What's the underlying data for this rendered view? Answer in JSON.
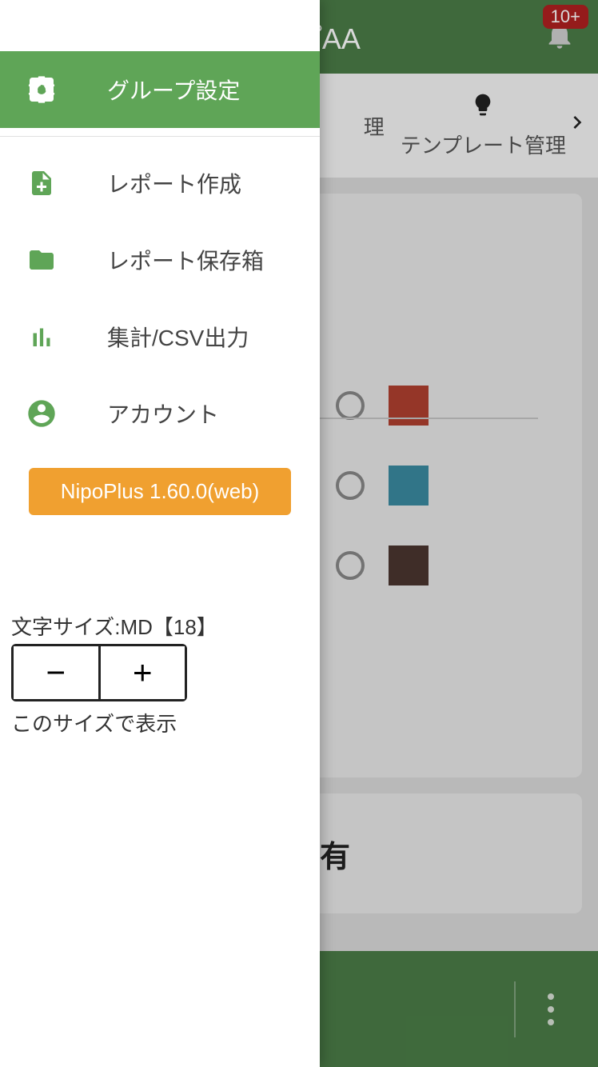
{
  "header": {
    "title_fragment": "ループAA",
    "badge_count": "10+"
  },
  "tabs": {
    "partial_label": "理",
    "template_label": "テンプレート管理"
  },
  "colors": {
    "swatch1": "#b04030",
    "swatch2": "#3a8aa0",
    "swatch3": "#4a3530"
  },
  "card2_text_fragment": "有",
  "drawer": {
    "items": [
      {
        "label": "グループ設定",
        "icon": "gear",
        "active": true
      },
      {
        "label": "レポート作成",
        "icon": "file-plus",
        "active": false
      },
      {
        "label": "レポート保存箱",
        "icon": "folder",
        "active": false
      },
      {
        "label": "集計/CSV出力",
        "icon": "bar-chart",
        "active": false
      },
      {
        "label": "アカウント",
        "icon": "user",
        "active": false
      }
    ],
    "version_label": "NipoPlus 1.60.0(web)"
  },
  "font_size": {
    "label": "文字サイズ:MD【18】",
    "minus": "−",
    "plus": "+",
    "caption": "このサイズで表示"
  }
}
